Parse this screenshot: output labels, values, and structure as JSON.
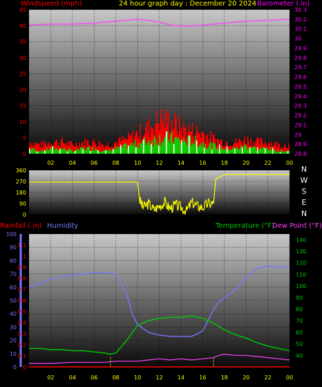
{
  "chart_data": [
    {
      "type": "line",
      "header": {
        "left_label": "Windspeed (mph)",
        "center_label": "24 hour graph day : December 20 2024",
        "right_label": "Barometer (.in)"
      },
      "colors": {
        "left_label": "#ff0000",
        "center_label": "#ffff00",
        "right_label": "#ff00ff",
        "wind_gust": "#ff0000",
        "wind_avg": "#00dd00",
        "wind_avg2": "#ffffff",
        "barometer": "#ff44ff"
      },
      "x_ticks": [
        "02",
        "04",
        "06",
        "08",
        "10",
        "12",
        "14",
        "16",
        "18",
        "20",
        "22",
        "00"
      ],
      "y_left_ticks": [
        "45",
        "40",
        "35",
        "30",
        "25",
        "20",
        "15",
        "10",
        "5",
        "0"
      ],
      "y_left_range": [
        0,
        45
      ],
      "y_right_ticks": [
        "30.3",
        "30.2",
        "30.1",
        "30",
        "29.9",
        "29.8",
        "29.7",
        "29.6",
        "29.5",
        "29.4",
        "29.3",
        "29.2",
        "29.1",
        "29",
        "28.9",
        "28.8"
      ],
      "y_right_range": [
        28.8,
        30.3
      ],
      "series": [
        {
          "name": "Barometer",
          "axis": "right",
          "x": [
            0,
            2,
            4,
            6,
            8,
            9,
            10,
            11,
            12,
            13,
            14,
            15,
            16,
            18,
            20,
            22,
            24
          ],
          "y": [
            30.14,
            30.15,
            30.15,
            30.16,
            30.18,
            30.19,
            30.2,
            30.19,
            30.17,
            30.14,
            30.13,
            30.13,
            30.14,
            30.16,
            30.18,
            30.19,
            30.2
          ]
        },
        {
          "name": "Windspeed",
          "axis": "left",
          "x": [
            0,
            1,
            2,
            3,
            4,
            5,
            6,
            7,
            8,
            9,
            10,
            11,
            12,
            13,
            14,
            15,
            16,
            17,
            18,
            19,
            20,
            21,
            22,
            23,
            24
          ],
          "y": [
            2,
            1,
            2,
            2,
            1,
            2,
            2,
            1,
            2,
            3,
            4,
            5,
            6,
            6,
            5,
            5,
            4,
            3,
            2,
            2,
            3,
            2,
            2,
            1,
            1
          ]
        },
        {
          "name": "Gust",
          "axis": "left",
          "x": [
            0,
            1,
            2,
            3,
            4,
            5,
            6,
            7,
            8,
            9,
            10,
            11,
            12,
            13,
            14,
            15,
            16,
            17,
            18,
            19,
            20,
            21,
            22,
            23,
            24
          ],
          "y": [
            4,
            3,
            4,
            4,
            3,
            4,
            4,
            3,
            4,
            5,
            7,
            9,
            12,
            11,
            9,
            8,
            7,
            5,
            4,
            4,
            5,
            4,
            4,
            3,
            3
          ]
        }
      ],
      "grid": true
    },
    {
      "type": "line",
      "side_labels": [
        "N",
        "W",
        "S",
        "E",
        "N"
      ],
      "colors": {
        "direction": "#ffff00"
      },
      "y_ticks": [
        "360",
        "270",
        "180",
        "90",
        "0"
      ],
      "y_range": [
        0,
        360
      ],
      "series": [
        {
          "name": "Wind Direction",
          "x": [
            0,
            2,
            4,
            6,
            8,
            10,
            10.2,
            10.5,
            11,
            11.5,
            12,
            12.5,
            13,
            13.5,
            14,
            14.5,
            15,
            15.5,
            16,
            16.5,
            17,
            17.2,
            18,
            20,
            22,
            24
          ],
          "y": [
            265,
            265,
            265,
            265,
            265,
            265,
            120,
            60,
            90,
            40,
            70,
            100,
            50,
            80,
            60,
            30,
            100,
            70,
            60,
            90,
            90,
            290,
            325,
            325,
            325,
            325
          ]
        }
      ],
      "grid": true
    },
    {
      "type": "line",
      "header": {
        "rain_label": "Rainfall (.in)",
        "humidity_label": "Humidity",
        "temp_label": "Temperature (°F)",
        "dew_label": "Dew Point (°F)"
      },
      "colors": {
        "rain": "#ff0000",
        "humidity": "#7777ff",
        "temperature": "#00cc00",
        "dew": "#ff44ff"
      },
      "y_humidity_ticks": [
        "100",
        "90",
        "80",
        "70",
        "60",
        "50",
        "40",
        "30",
        "20",
        "10",
        "0"
      ],
      "y_humidity_range": [
        0,
        100
      ],
      "y_rain_ticks": [
        "1.1",
        "1",
        "0.9",
        "0.8",
        "0.7",
        "0.6",
        "0.5",
        "0.4",
        "0.3",
        "0.2",
        "0.1",
        "0"
      ],
      "y_rain_range": [
        0,
        1.2
      ],
      "y_temp_ticks": [
        "140",
        "130",
        "120",
        "110",
        "100",
        "90",
        "80",
        "70",
        "60",
        "50",
        "40"
      ],
      "y_temp_range": [
        30,
        145
      ],
      "series": [
        {
          "name": "Humidity",
          "axis": "humidity",
          "x": [
            0,
            1,
            2,
            3,
            4,
            5,
            6,
            7,
            8,
            9,
            9.5,
            10,
            11,
            12,
            13,
            14,
            15,
            16,
            16.5,
            17,
            17.5,
            18,
            19,
            20,
            21,
            22,
            23,
            24
          ],
          "y": [
            60,
            63,
            66,
            68,
            69,
            70,
            71,
            71,
            70,
            55,
            40,
            32,
            26,
            24,
            23,
            23,
            23,
            27,
            35,
            43,
            49,
            52,
            58,
            67,
            74,
            76,
            75,
            75
          ]
        },
        {
          "name": "Temperature",
          "axis": "temp",
          "x": [
            0,
            1,
            2,
            3,
            4,
            5,
            6,
            7,
            7.5,
            8,
            9,
            10,
            11,
            12,
            13,
            14,
            15,
            16,
            17,
            18,
            19,
            20,
            21,
            22,
            23,
            24
          ],
          "y": [
            46,
            46,
            45,
            45,
            44,
            44,
            43,
            42,
            41,
            42,
            53,
            66,
            70,
            72,
            73,
            73,
            74,
            72,
            68,
            62,
            58,
            55,
            51,
            48,
            46,
            44
          ]
        },
        {
          "name": "Dew Point",
          "axis": "temp",
          "x": [
            0,
            2,
            4,
            6,
            7,
            8,
            9,
            10,
            11,
            12,
            13,
            14,
            15,
            16,
            17,
            17.5,
            18,
            19,
            20,
            21,
            22,
            23,
            24
          ],
          "y": [
            33,
            33,
            34,
            34,
            34,
            35,
            35,
            35,
            36,
            37,
            36,
            37,
            36,
            37,
            38,
            40,
            41,
            40,
            40,
            39,
            38,
            37,
            36
          ]
        },
        {
          "name": "Rainfall",
          "axis": "rain",
          "x": [
            0,
            24
          ],
          "y": [
            0,
            0
          ]
        }
      ],
      "grid": true
    }
  ]
}
